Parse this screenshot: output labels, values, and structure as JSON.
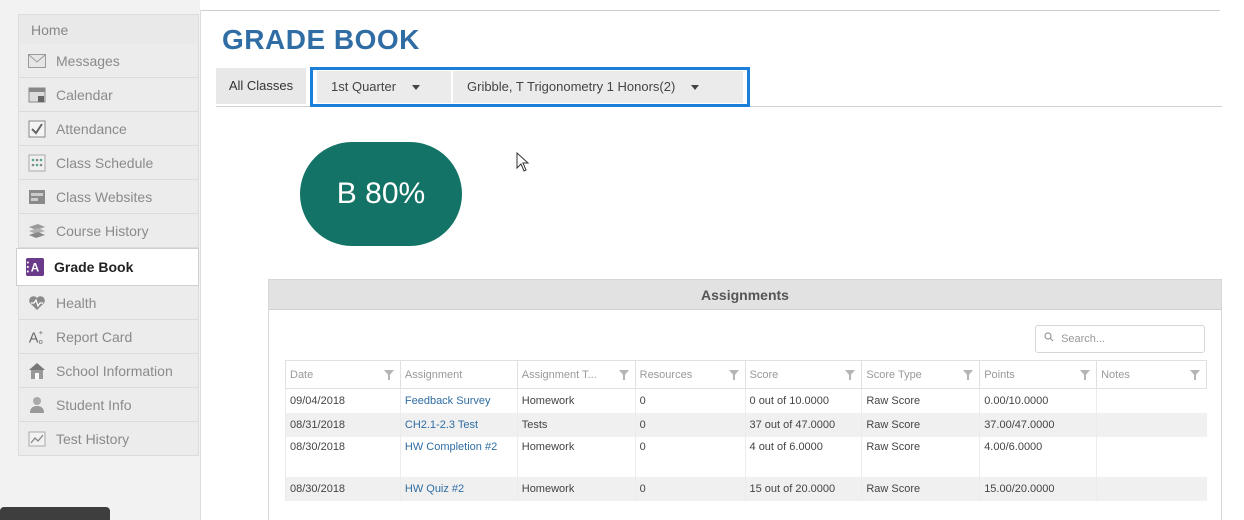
{
  "sidebar": {
    "home": "Home",
    "items": [
      {
        "label": "Messages",
        "icon": "envelope-icon"
      },
      {
        "label": "Calendar",
        "icon": "calendar-icon"
      },
      {
        "label": "Attendance",
        "icon": "checkbox-icon"
      },
      {
        "label": "Class Schedule",
        "icon": "schedule-icon"
      },
      {
        "label": "Class Websites",
        "icon": "websites-icon"
      },
      {
        "label": "Course History",
        "icon": "course-history-icon"
      },
      {
        "label": "Grade Book",
        "icon": "grade-book-icon",
        "active": true
      },
      {
        "label": "Health",
        "icon": "health-icon"
      },
      {
        "label": "Report Card",
        "icon": "report-card-icon"
      },
      {
        "label": "School Information",
        "icon": "school-icon"
      },
      {
        "label": "Student Info",
        "icon": "student-icon"
      },
      {
        "label": "Test History",
        "icon": "test-history-icon"
      }
    ]
  },
  "header": {
    "title": "GRADE BOOK"
  },
  "toolbar": {
    "all_classes": "All Classes",
    "quarter": "1st Quarter",
    "class": "Gribble, T Trigonometry 1 Honors(2)"
  },
  "grade": {
    "text": "B 80%",
    "color": "#137366"
  },
  "assignments": {
    "title": "Assignments",
    "search_placeholder": "Search...",
    "columns": [
      "Date",
      "Assignment",
      "Assignment T...",
      "Resources",
      "Score",
      "Score Type",
      "Points",
      "Notes"
    ],
    "rows": [
      {
        "date": "09/04/2018",
        "assignment": "Feedback Survey",
        "type": "Homework",
        "resources": "0",
        "score": "0 out of 10.0000",
        "score_type": "Raw Score",
        "points": "0.00/10.0000",
        "notes": ""
      },
      {
        "date": "08/31/2018",
        "assignment": "CH2.1-2.3 Test",
        "type": "Tests",
        "resources": "0",
        "score": "37 out of 47.0000",
        "score_type": "Raw Score",
        "points": "37.00/47.0000",
        "notes": ""
      },
      {
        "date": "08/30/2018",
        "assignment": "HW Completion #2",
        "type": "Homework",
        "resources": "0",
        "score": "4 out of 6.0000",
        "score_type": "Raw Score",
        "points": "4.00/6.0000",
        "notes": ""
      },
      {
        "date": "08/30/2018",
        "assignment": "HW Quiz #2",
        "type": "Homework",
        "resources": "0",
        "score": "15 out of 20.0000",
        "score_type": "Raw Score",
        "points": "15.00/20.0000",
        "notes": ""
      }
    ]
  },
  "colors": {
    "accent": "#2f6da4",
    "highlight_border": "#1a7fd9"
  }
}
